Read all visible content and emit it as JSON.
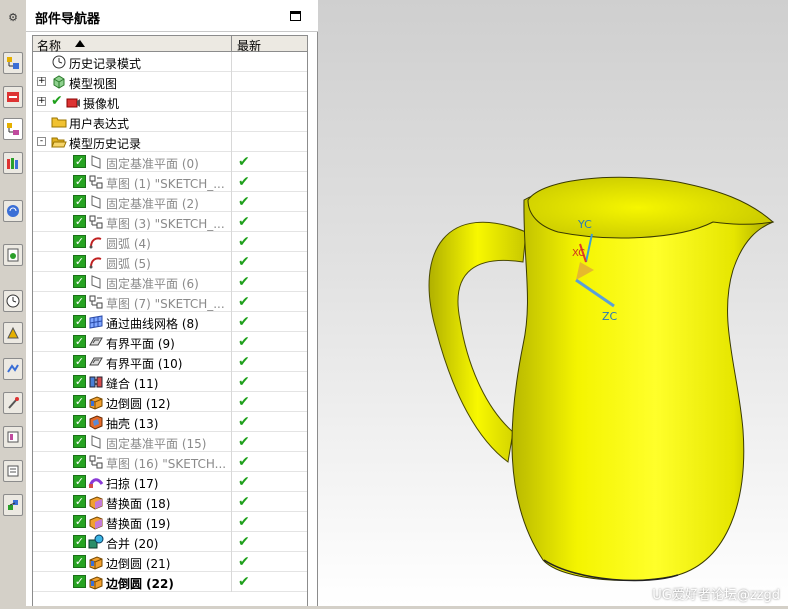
{
  "navigator": {
    "title": "部件导航器",
    "columns": {
      "name": "名称",
      "latest": "最新"
    }
  },
  "tree": [
    {
      "label": "历史记录模式",
      "icon": "clock-icon",
      "level": 0,
      "checkbox": false,
      "dim": false,
      "latest": false
    },
    {
      "label": "模型视图",
      "icon": "model-view-icon",
      "level": 0,
      "expander": "+",
      "checkbox": false,
      "dim": false,
      "latest": false
    },
    {
      "label": "摄像机",
      "icon": "camera-icon",
      "level": 0,
      "expander": "+",
      "checkbox": false,
      "check_mark": true,
      "dim": false,
      "latest": false
    },
    {
      "label": "用户表达式",
      "icon": "folder-icon",
      "level": 0,
      "checkbox": false,
      "dim": false,
      "latest": false
    },
    {
      "label": "模型历史记录",
      "icon": "folder-open-icon",
      "level": 0,
      "expander": "-",
      "checkbox": false,
      "dim": false,
      "latest": false
    },
    {
      "label": "固定基准平面 (0)",
      "icon": "datum-plane-icon",
      "level": 1,
      "checkbox": true,
      "dim": true,
      "latest": true
    },
    {
      "label": "草图 (1) \"SKETCH_...",
      "icon": "sketch-icon",
      "level": 1,
      "checkbox": true,
      "dim": true,
      "latest": true
    },
    {
      "label": "固定基准平面 (2)",
      "icon": "datum-plane-icon",
      "level": 1,
      "checkbox": true,
      "dim": true,
      "latest": true
    },
    {
      "label": "草图 (3) \"SKETCH_...",
      "icon": "sketch-icon",
      "level": 1,
      "checkbox": true,
      "dim": true,
      "latest": true
    },
    {
      "label": "圆弧 (4)",
      "icon": "arc-icon",
      "level": 1,
      "checkbox": true,
      "dim": true,
      "latest": true
    },
    {
      "label": "圆弧 (5)",
      "icon": "arc-icon",
      "level": 1,
      "checkbox": true,
      "dim": true,
      "latest": true
    },
    {
      "label": "固定基准平面 (6)",
      "icon": "datum-plane-icon",
      "level": 1,
      "checkbox": true,
      "dim": true,
      "latest": true
    },
    {
      "label": "草图 (7) \"SKETCH_...",
      "icon": "sketch-icon",
      "level": 1,
      "checkbox": true,
      "dim": true,
      "latest": true
    },
    {
      "label": "通过曲线网格 (8)",
      "icon": "curve-mesh-icon",
      "level": 1,
      "checkbox": true,
      "dim": false,
      "latest": true
    },
    {
      "label": "有界平面 (9)",
      "icon": "bounded-plane-icon",
      "level": 1,
      "checkbox": true,
      "dim": false,
      "latest": true
    },
    {
      "label": "有界平面 (10)",
      "icon": "bounded-plane-icon",
      "level": 1,
      "checkbox": true,
      "dim": false,
      "latest": true
    },
    {
      "label": "缝合 (11)",
      "icon": "sew-icon",
      "level": 1,
      "checkbox": true,
      "dim": false,
      "latest": true
    },
    {
      "label": "边倒圆 (12)",
      "icon": "edge-blend-icon",
      "level": 1,
      "checkbox": true,
      "dim": false,
      "latest": true
    },
    {
      "label": "抽壳 (13)",
      "icon": "shell-icon",
      "level": 1,
      "checkbox": true,
      "dim": false,
      "latest": true
    },
    {
      "label": "固定基准平面 (15)",
      "icon": "datum-plane-icon",
      "level": 1,
      "checkbox": true,
      "dim": true,
      "latest": true
    },
    {
      "label": "草图 (16) \"SKETCH...",
      "icon": "sketch-icon",
      "level": 1,
      "checkbox": true,
      "dim": true,
      "latest": true
    },
    {
      "label": "扫掠 (17)",
      "icon": "sweep-icon",
      "level": 1,
      "checkbox": true,
      "dim": false,
      "latest": true
    },
    {
      "label": "替换面 (18)",
      "icon": "replace-face-icon",
      "level": 1,
      "checkbox": true,
      "dim": false,
      "latest": true
    },
    {
      "label": "替换面 (19)",
      "icon": "replace-face-icon",
      "level": 1,
      "checkbox": true,
      "dim": false,
      "latest": true
    },
    {
      "label": "合并 (20)",
      "icon": "unite-icon",
      "level": 1,
      "checkbox": true,
      "dim": false,
      "latest": true
    },
    {
      "label": "边倒圆 (21)",
      "icon": "edge-blend-icon",
      "level": 1,
      "checkbox": true,
      "dim": false,
      "latest": true
    },
    {
      "label": "边倒圆 (22)",
      "icon": "edge-blend-icon",
      "level": 1,
      "checkbox": true,
      "dim": false,
      "bold": true,
      "latest": true
    }
  ],
  "viewport": {
    "axis_labels": {
      "yc": "YC",
      "xc": "XC",
      "zc": "ZC"
    },
    "watermark": "UG爱好者论坛@zzgd",
    "model_color": "#f2f200"
  },
  "colors": {
    "check_green": "#27a322",
    "latest_green": "#1fa01c"
  }
}
